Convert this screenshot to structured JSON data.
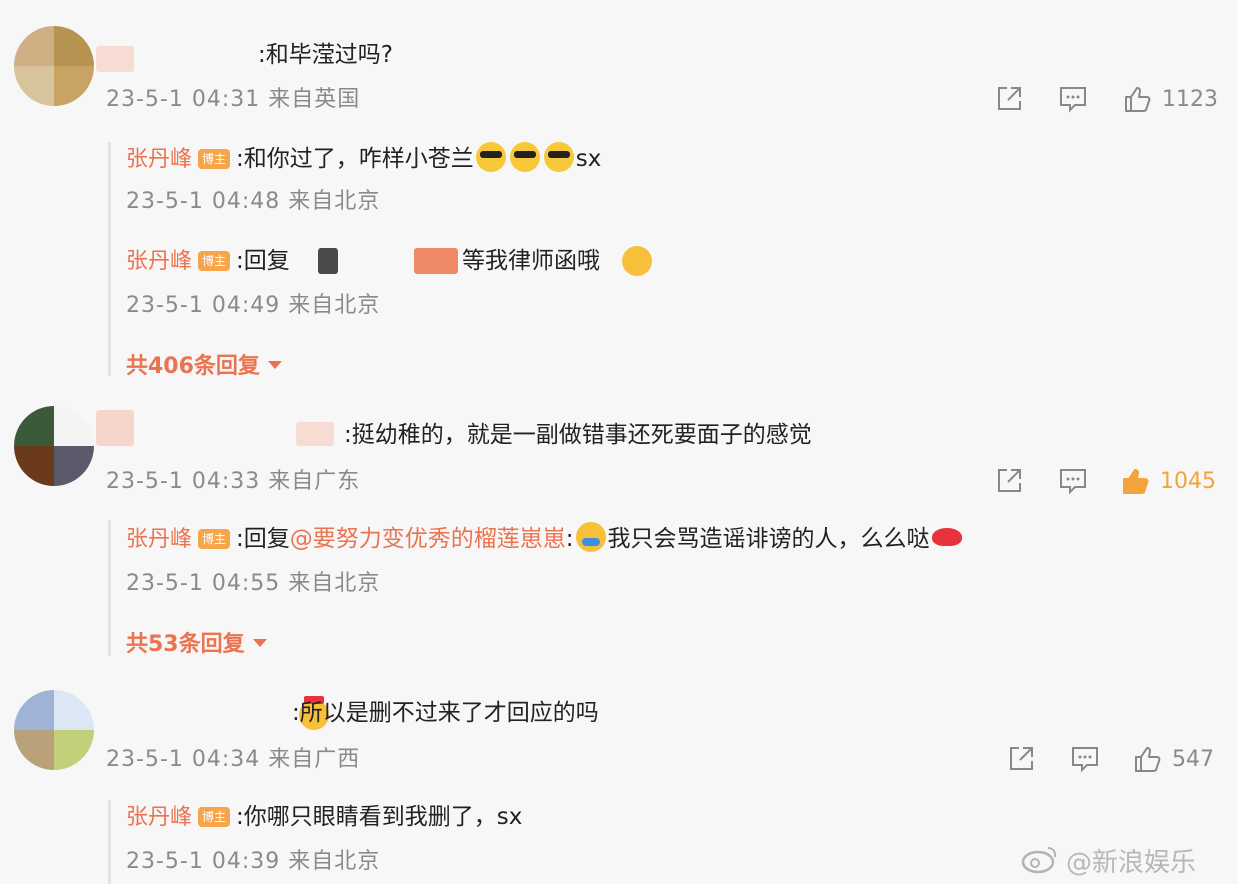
{
  "comments": [
    {
      "text": ":和毕滢过吗?",
      "meta": "23-5-1 04:31 来自英国",
      "likes": "1123",
      "replies": [
        {
          "author": "张丹峰",
          "badge": "博主",
          "text": ":和你过了，咋样小苍兰",
          "tail": "sx",
          "meta": "23-5-1 04:48 来自北京"
        },
        {
          "author": "张丹峰",
          "badge": "博主",
          "prefix": ":回复",
          "text": "等我律师函哦",
          "meta": "23-5-1 04:49 来自北京"
        }
      ],
      "more": "共406条回复"
    },
    {
      "text": ":挺幼稚的，就是一副做错事还死要面子的感觉",
      "meta": "23-5-1 04:33 来自广东",
      "likes": "1045",
      "replies": [
        {
          "author": "张丹峰",
          "badge": "博主",
          "prefix": ":回复",
          "mention": "@要努力变优秀的榴莲崽崽",
          "text": "我只会骂造谣诽谤的人，么么哒",
          "meta": "23-5-1 04:55 来自北京"
        }
      ],
      "more": "共53条回复"
    },
    {
      "text": ":所以是删不过来了才回应的吗",
      "meta": "23-5-1 04:34 来自广西",
      "likes": "547",
      "replies": [
        {
          "author": "张丹峰",
          "badge": "博主",
          "text": ":你哪只眼睛看到我删了，sx",
          "meta": "23-5-1 04:39 来自北京"
        }
      ]
    }
  ],
  "colors": {
    "accent": "#eb7350",
    "like_active": "#f0a43a",
    "meta": "#8a8a8a"
  },
  "icons": [
    "share-icon",
    "comment-icon",
    "like-icon",
    "caret-down-icon",
    "weibo-logo-icon"
  ],
  "watermark": "@新浪娱乐"
}
